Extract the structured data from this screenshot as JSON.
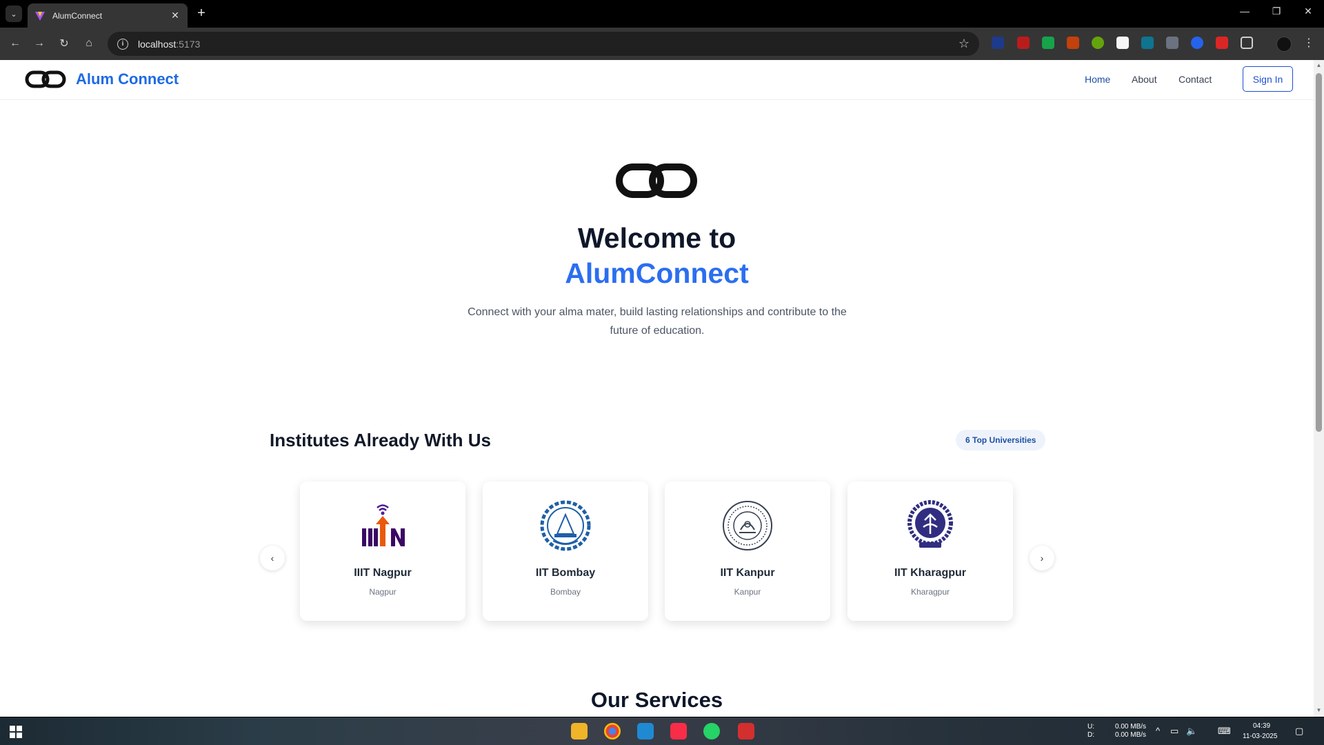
{
  "browser": {
    "tab_title": "AlumConnect",
    "url_host": "localhost",
    "url_port": ":5173"
  },
  "site": {
    "brand": "Alum Connect",
    "nav": [
      "Home",
      "About",
      "Contact"
    ],
    "signin": "Sign In"
  },
  "hero": {
    "line1": "Welcome to",
    "line2": "AlumConnect",
    "subtitle": "Connect with your alma mater, build lasting relationships and contribute to the future of education."
  },
  "institutes": {
    "title": "Institutes Already With Us",
    "badge": "6 Top Universities",
    "items": [
      {
        "name": "IIIT Nagpur",
        "city": "Nagpur"
      },
      {
        "name": "IIT Bombay",
        "city": "Bombay"
      },
      {
        "name": "IIT Kanpur",
        "city": "Kanpur"
      },
      {
        "name": "IIT Kharagpur",
        "city": "Kharagpur"
      }
    ]
  },
  "services": {
    "title": "Our Services"
  },
  "tray": {
    "upload_label": "U:",
    "download_label": "D:",
    "upload_speed": "0.00 MB/s",
    "download_speed": "0.00 MB/s",
    "time": "04:39",
    "date": "11-03-2025"
  }
}
